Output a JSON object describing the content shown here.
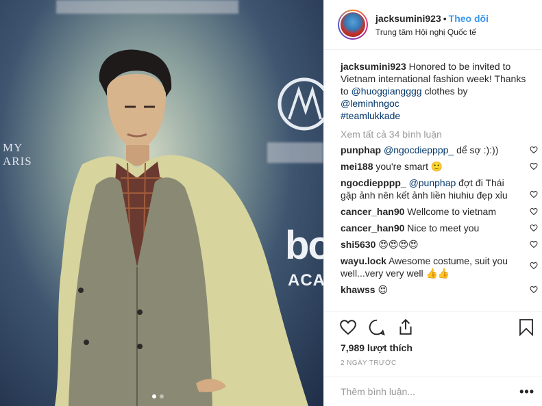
{
  "post": {
    "author": "jacksumini923",
    "separator": "•",
    "follow_label": "Theo dõi",
    "location": "Trung tâm Hội nghị Quốc tế",
    "photo": {
      "side_text_1": "MY",
      "side_text_2": "ARIS",
      "logo_text": "bo",
      "logo_subtext": "ACA"
    },
    "caption": {
      "username": "jacksumini923",
      "text_1": " Honored to be invited to Vietnam international fashion week! Thanks to ",
      "mention_1": "@huoggiangggg",
      "text_2": " clothes by ",
      "mention_2": "@leminhngoc",
      "hashtag": "#teamlukkade"
    },
    "view_all_comments": "Xem tất cả 34 bình luận",
    "comments": [
      {
        "user": "punphap",
        "mention": "@ngocdiepppp_",
        "text": " dể sợ :):))"
      },
      {
        "user": "mei188",
        "mention": "",
        "text": "you're smart 🙂"
      },
      {
        "user": "ngocdiepppp_",
        "mention": "@punphap",
        "text": " đợt đi Thái gặp ảnh nên kết ảnh liền hiuhiu đẹp xỉu"
      },
      {
        "user": "cancer_han90",
        "mention": "",
        "text": "Wellcome to vietnam"
      },
      {
        "user": "cancer_han90",
        "mention": "",
        "text": "Nice to meet you"
      },
      {
        "user": "shi5630",
        "mention": "",
        "text": "😍😍😍😍"
      },
      {
        "user": "wayu.lock",
        "mention": "",
        "text": "Awesome costume, suit you well...very very well 👍👍"
      },
      {
        "user": "khawss",
        "mention": "",
        "text": "😍"
      }
    ],
    "likes_count": "7,989 lượt thích",
    "posted_ago": "2 NGÀY TRƯỚC",
    "add_comment_placeholder": "Thêm bình luận...",
    "more_label": "•••",
    "carousel_active_index": 0,
    "carousel_total": 2
  },
  "colors": {
    "link_blue": "#3897f0",
    "mention_navy": "#003569",
    "muted_gray": "#999999",
    "border": "#efefef"
  },
  "icons": {
    "like": "heart-icon",
    "comment": "comment-icon",
    "share": "share-icon",
    "save": "bookmark-icon",
    "comment_like": "heart-icon-small",
    "more": "more-options-icon"
  }
}
